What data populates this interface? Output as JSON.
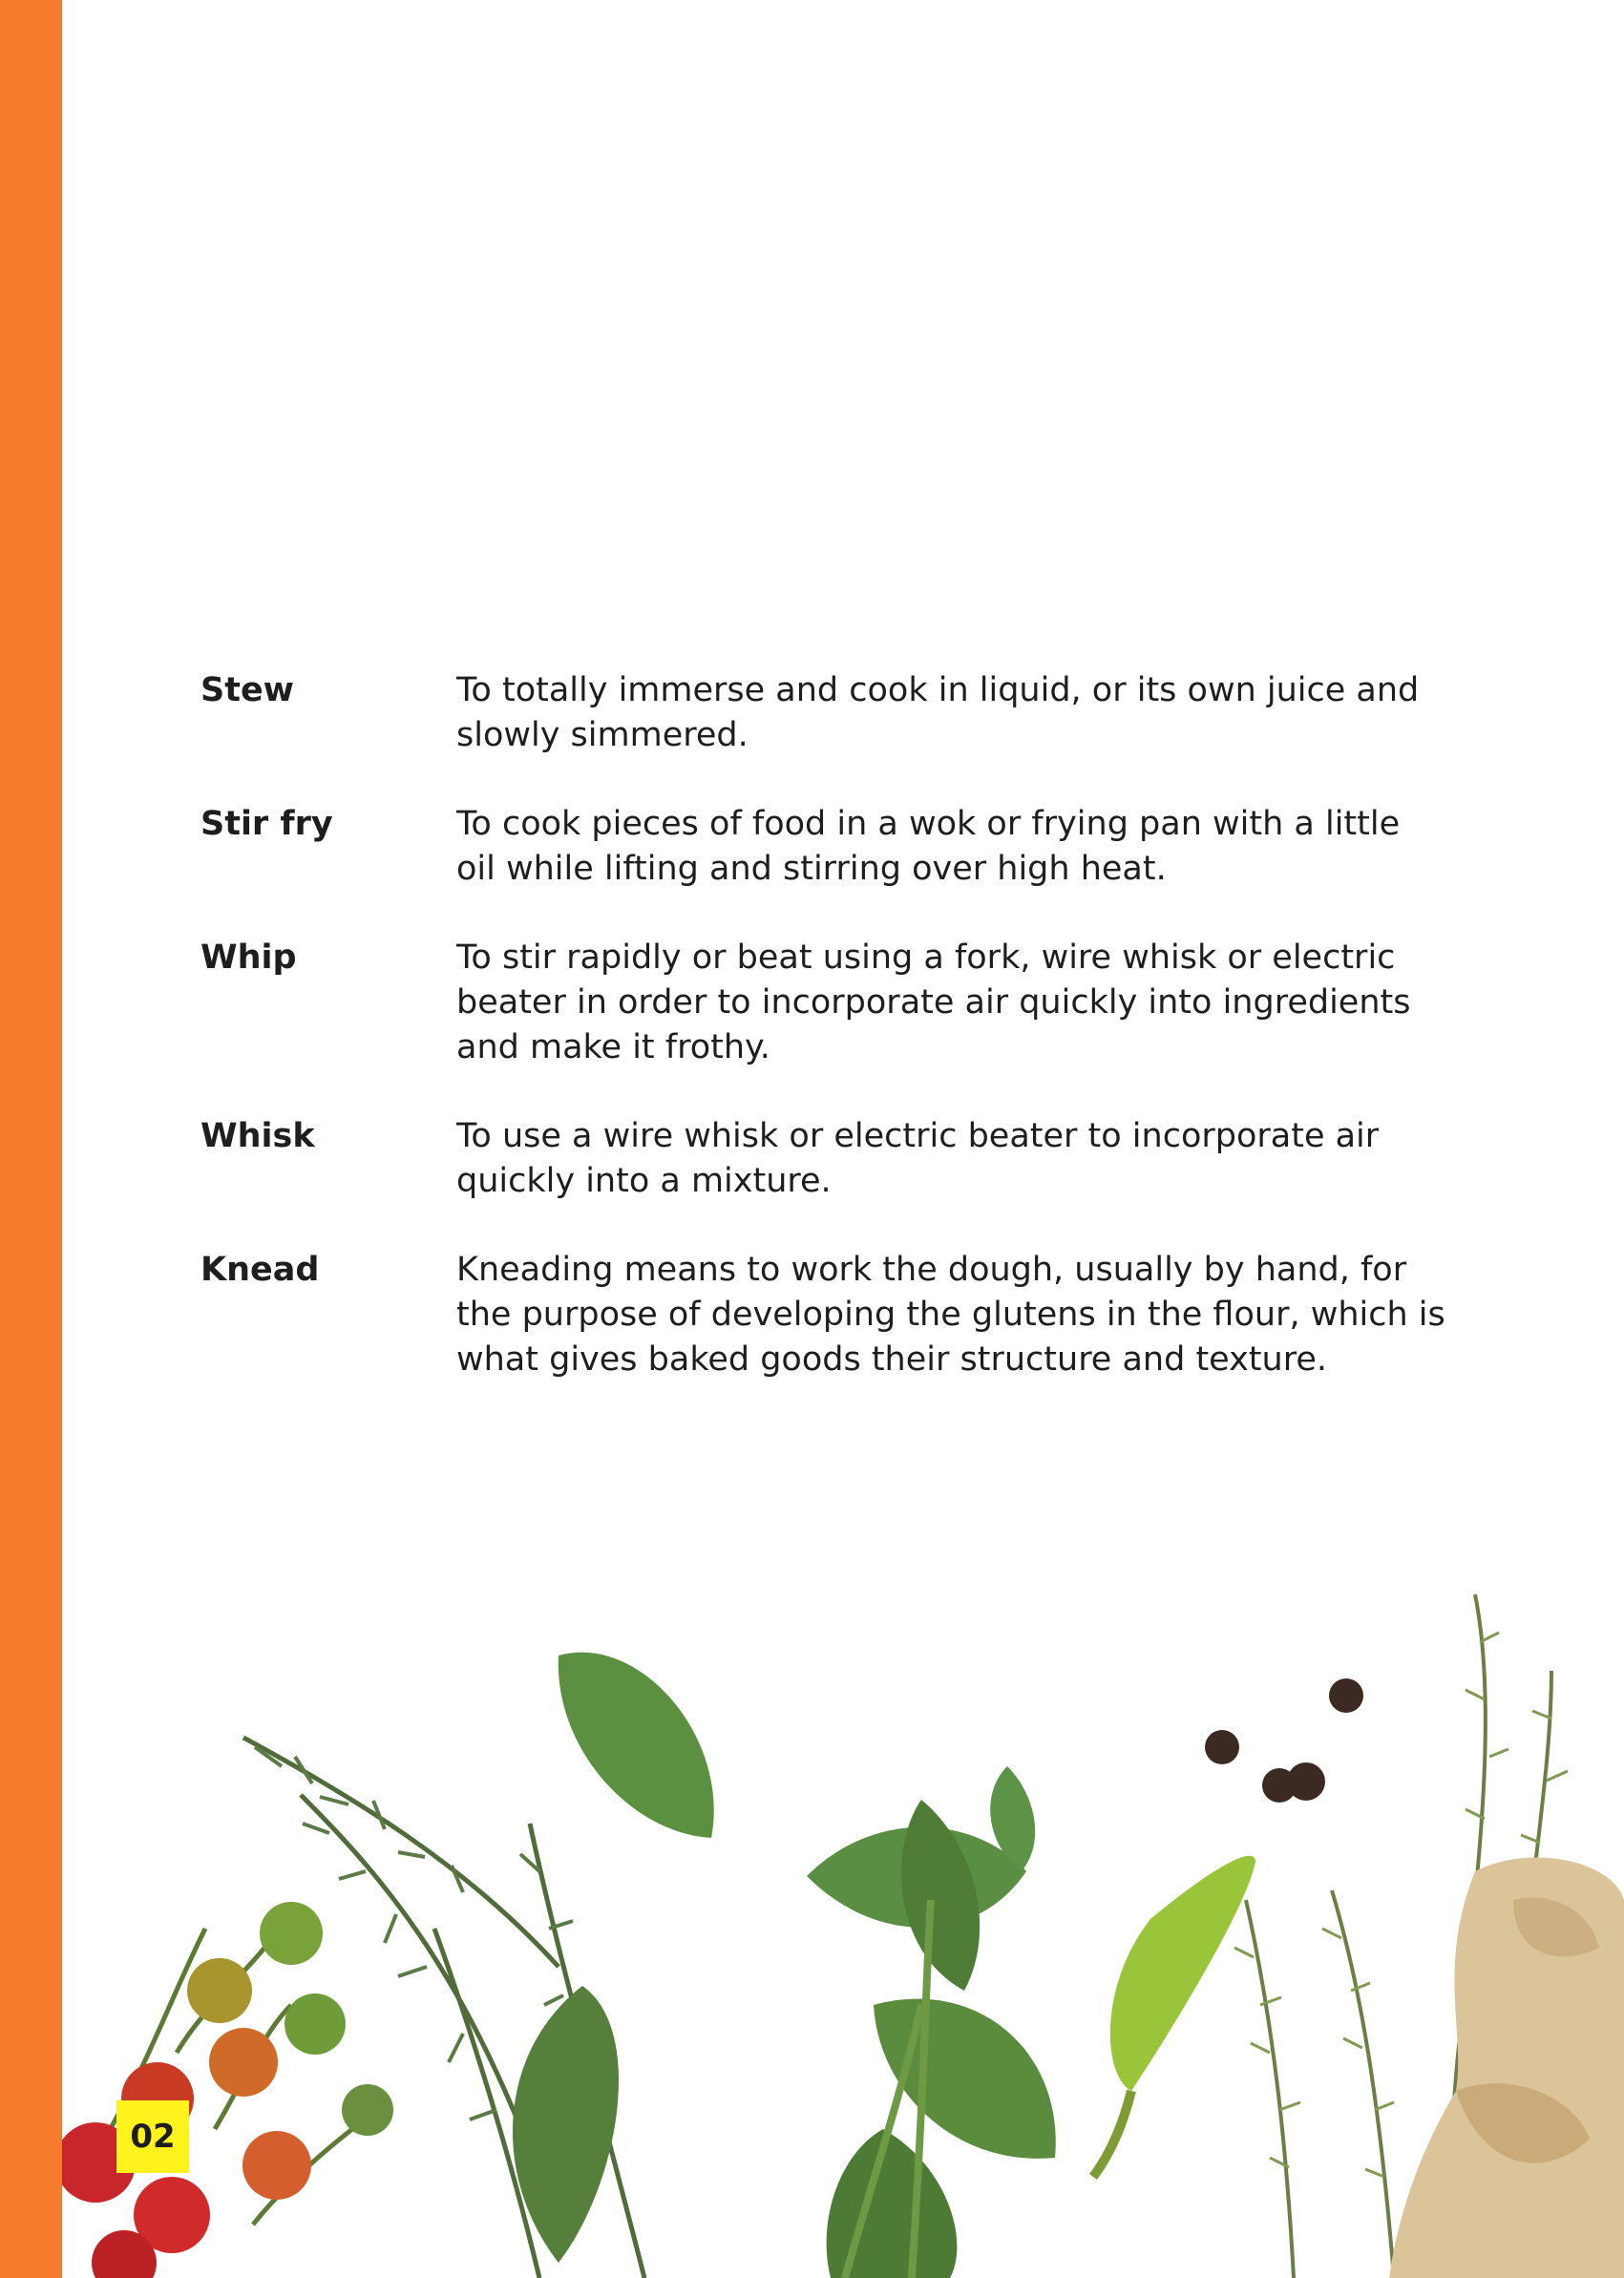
{
  "glossary": [
    {
      "term": "Stew",
      "definition": "To totally immerse and cook in liquid, or its own juice and slowly simmered."
    },
    {
      "term": "Stir fry",
      "definition": "To cook pieces of food in a wok or frying pan with a little oil while lifting and stirring over high heat."
    },
    {
      "term": "Whip",
      "definition": "To stir rapidly or beat using a fork, wire whisk or electric beater in order to incorporate air quickly into ingredients and make it frothy."
    },
    {
      "term": "Whisk",
      "definition": "To use a wire whisk or electric beater to incorporate air quickly into a mixture."
    },
    {
      "term": "Knead",
      "definition": "Kneading means to work the dough, usually by hand, for the purpose of developing the glutens in the flour, which is what gives baked goods their structure and texture."
    }
  ],
  "page_number": "02",
  "colors": {
    "accent_bar": "#f47c2c",
    "page_badge": "#fff21d",
    "text": "#1e1e1e"
  }
}
